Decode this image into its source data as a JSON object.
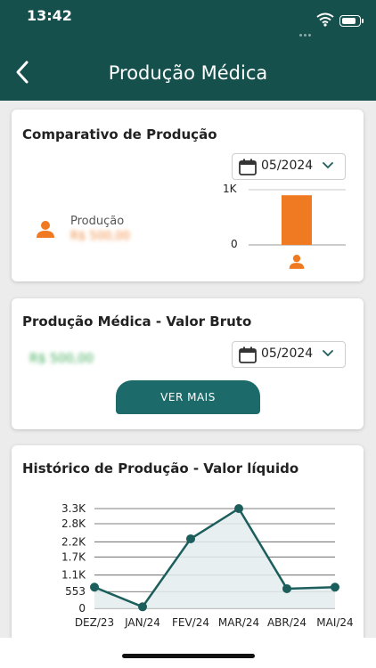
{
  "status_bar": {
    "time": "13:42"
  },
  "header": {
    "title": "Produção Médica"
  },
  "comparativo": {
    "title": "Comparativo de Produção",
    "date": "05/2024",
    "legend_label": "Produção",
    "legend_value": "R$ 500,00",
    "axis_ticks": [
      "1K",
      "0"
    ],
    "chart_data": {
      "type": "bar",
      "categories": [
        "Produção"
      ],
      "values": [
        900
      ],
      "ylim": [
        0,
        1000
      ],
      "colors": [
        "#f07a22"
      ]
    }
  },
  "valor_bruto": {
    "title": "Produção Médica - Valor Bruto",
    "value": "R$ 500,00",
    "date": "05/2024",
    "button": "VER MAIS"
  },
  "historico": {
    "title": "Histórico de Produção - Valor líquido",
    "chart_data": {
      "type": "area",
      "x": [
        "DEZ/23",
        "JAN/24",
        "FEV/24",
        "MAR/24",
        "ABR/24",
        "MAI/24"
      ],
      "values": [
        700,
        50,
        2300,
        3300,
        650,
        700
      ],
      "y_ticks": [
        3300,
        2800,
        2200,
        1700,
        1100,
        553,
        0
      ],
      "y_tick_labels": [
        "3.3K",
        "2.8K",
        "2.2K",
        "1.7K",
        "1.1K",
        "553",
        "0"
      ],
      "ylim": [
        0,
        3300
      ],
      "line_color": "#1c5e5c",
      "fill_color": "#e3ecef",
      "grid": true
    }
  }
}
